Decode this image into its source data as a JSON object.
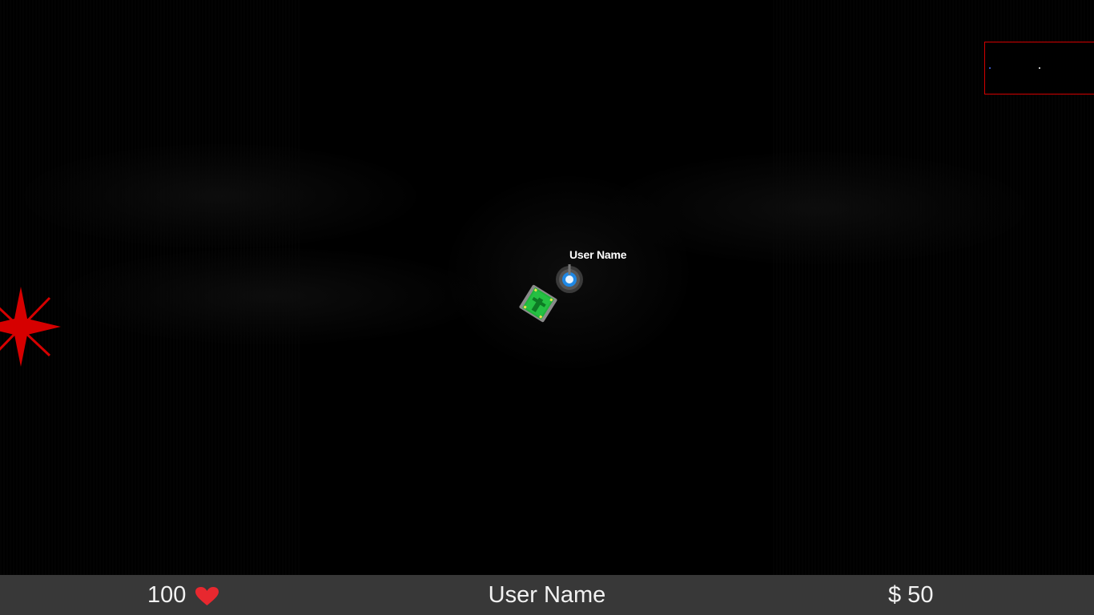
{
  "player": {
    "name": "User Name"
  },
  "hud": {
    "health": "100",
    "username": "User Name",
    "money": "$ 50",
    "heart_icon": "heart-icon",
    "heart_color": "#e8282f",
    "background_color": "#383838"
  },
  "minimap": {
    "border_color": "#d40000",
    "dots": [
      {
        "color": "#ffffff"
      },
      {
        "color": "#4a6cff"
      }
    ]
  },
  "colors": {
    "enemy": "#d60000",
    "pickup": "#1eb53a",
    "player_ring": "#1e88e5"
  }
}
